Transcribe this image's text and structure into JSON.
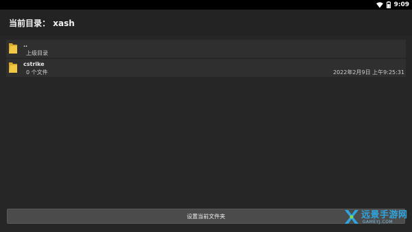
{
  "status_bar": {
    "time": "9:09"
  },
  "header": {
    "title": "当前目录： xash"
  },
  "entries": [
    {
      "name": "..",
      "subtitle": "上级目录",
      "date": ""
    },
    {
      "name": "cstrike",
      "subtitle": "0 个文件",
      "date": "2022年2月9日 上午9:25:31"
    }
  ],
  "actions": {
    "set_folder_label": "设置当前文件夹"
  },
  "watermark": {
    "name": "远景手游网",
    "url": "GAMEYJ.COM"
  },
  "colors": {
    "folder": "#f2c744",
    "accent": "#2fa6e0",
    "button": "#4b4b4b",
    "background": "#262626"
  },
  "icons": [
    "wifi-icon",
    "battery-icon",
    "folder-icon"
  ]
}
